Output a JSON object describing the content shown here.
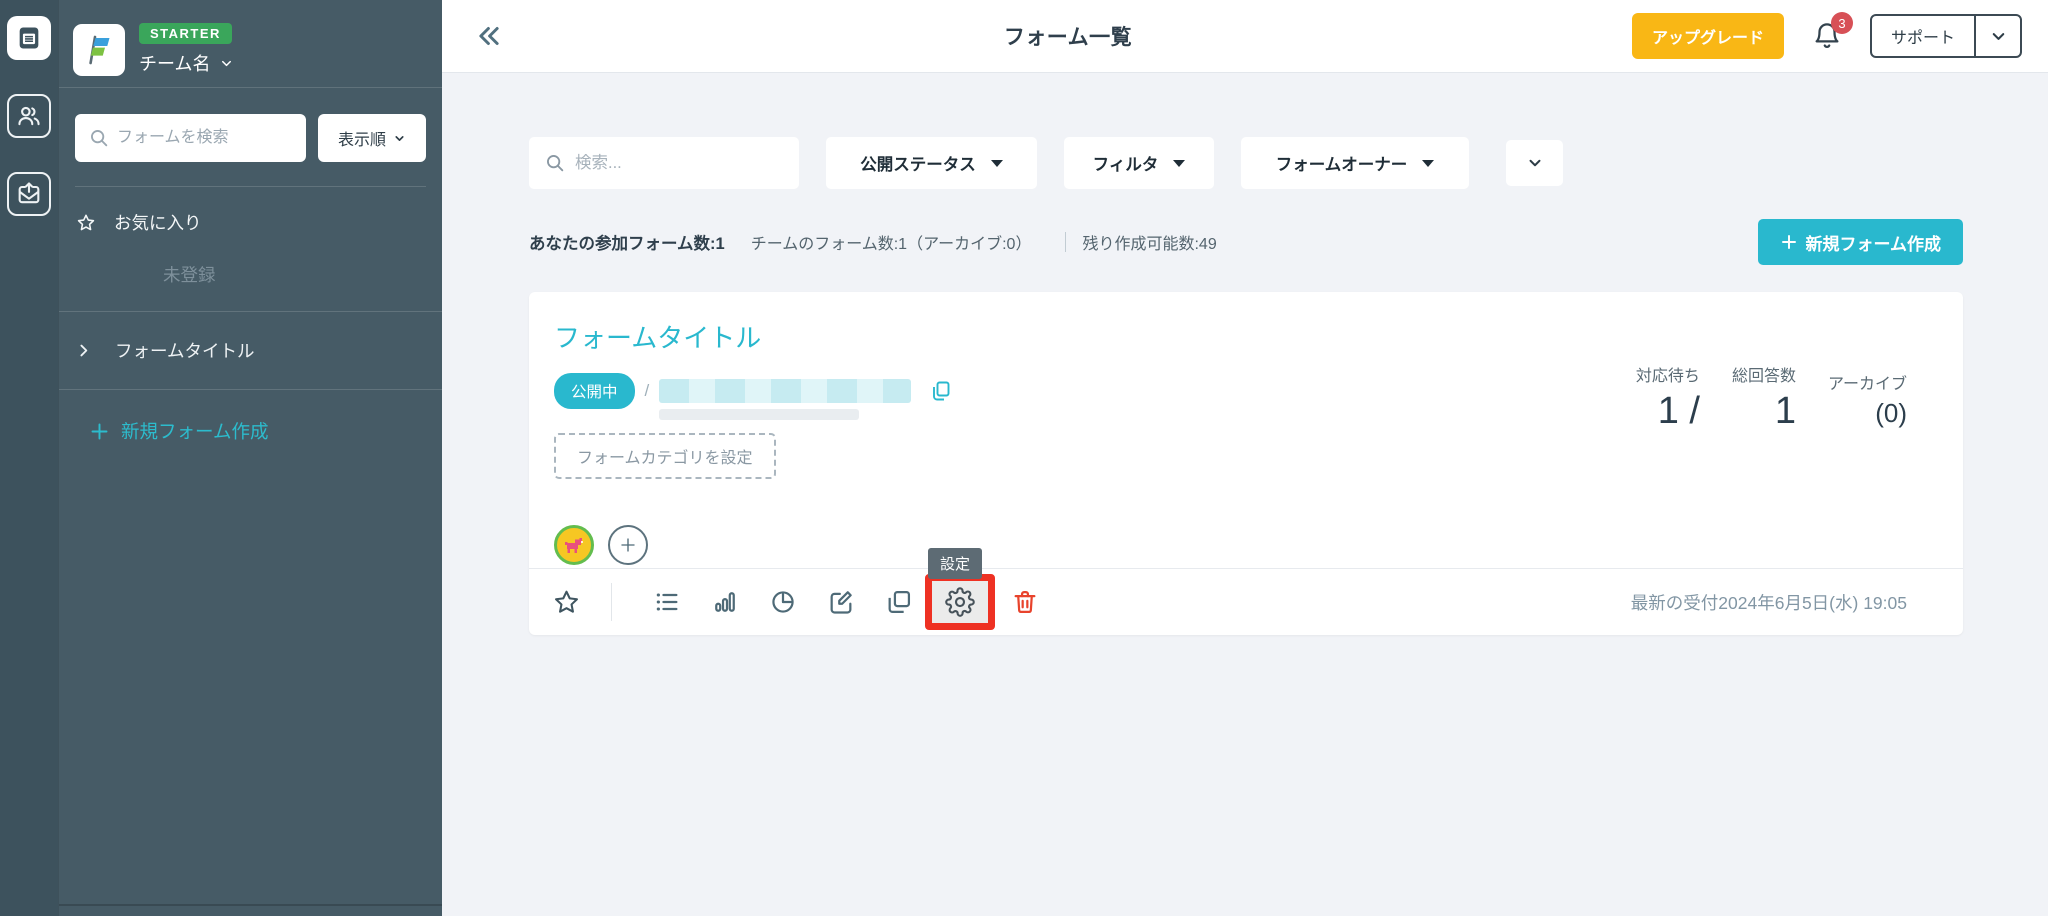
{
  "colors": {
    "accent_teal": "#29b8ce",
    "upgrade_amber": "#f9b715",
    "plan_green": "#3aa65b",
    "highlight_red": "#ee3123",
    "trash_red": "#e8432c",
    "sidebar_bg": "#465b66"
  },
  "sidebar": {
    "plan_badge": "STARTER",
    "team_name": "チーム名",
    "search_placeholder": "フォームを検索",
    "sort_label": "表示順",
    "favorites_label": "お気に入り",
    "favorites_empty": "未登録",
    "form_item_label": "フォームタイトル",
    "new_form_label": "新規フォーム作成"
  },
  "header": {
    "title": "フォーム一覧",
    "upgrade_label": "アップグレード",
    "notification_count": "3",
    "support_label": "サポート"
  },
  "filters": {
    "search_placeholder": "検索...",
    "status_label": "公開ステータス",
    "filter_label": "フィルタ",
    "owner_label": "フォームオーナー"
  },
  "stats_bar": {
    "participating": "あなたの参加フォーム数:1",
    "team": "チームのフォーム数:1（アーカイブ:0）",
    "remaining": "残り作成可能数:49"
  },
  "new_form_button_label": "新規フォーム作成",
  "card": {
    "title": "フォームタイトル",
    "status": "公開中",
    "url_prefix": "/",
    "category_button_label": "フォームカテゴリを設定",
    "stats": [
      {
        "label": "対応待ち",
        "value": "1 /"
      },
      {
        "label": "総回答数",
        "value": "1"
      },
      {
        "label": "アーカイブ",
        "value": "(0)"
      }
    ],
    "settings_tooltip": "設定",
    "latest_submission": "最新の受付2024年6月5日(水) 19:05"
  }
}
